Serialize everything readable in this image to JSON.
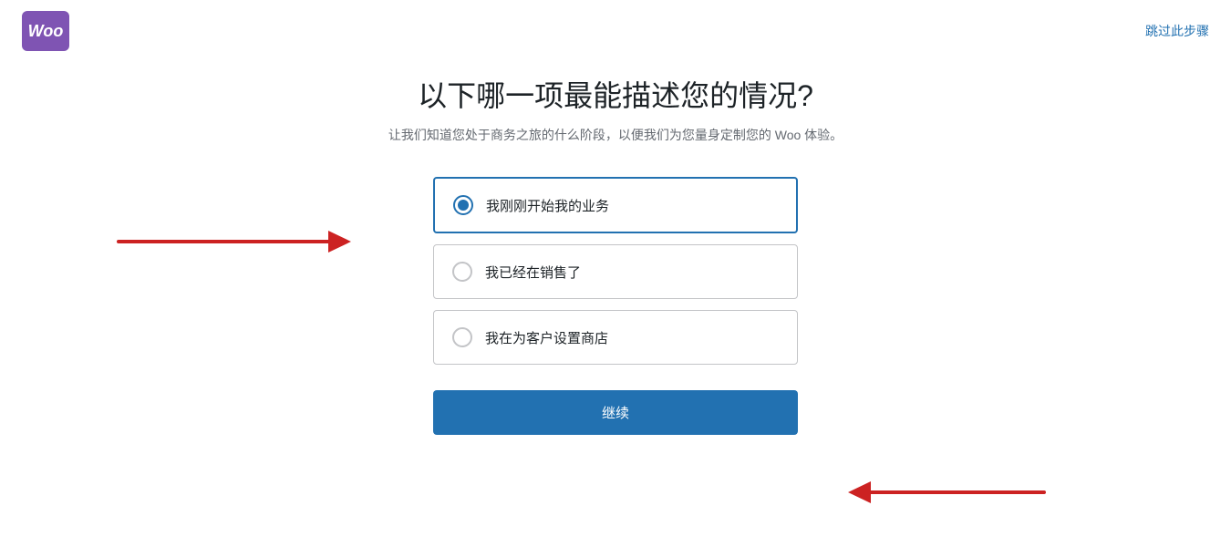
{
  "header": {
    "logo_text": "Woo",
    "skip_label": "跳过此步骤"
  },
  "main": {
    "title": "以下哪一项最能描述您的情况?",
    "subtitle": "让我们知道您处于商务之旅的什么阶段，以便我们为您量身定制您的 Woo 体验。",
    "options": [
      {
        "id": "option-1",
        "label": "我刚刚开始我的业务",
        "selected": true
      },
      {
        "id": "option-2",
        "label": "我已经在销售了",
        "selected": false
      },
      {
        "id": "option-3",
        "label": "我在为客户设置商店",
        "selected": false
      }
    ],
    "continue_button": "继续"
  }
}
